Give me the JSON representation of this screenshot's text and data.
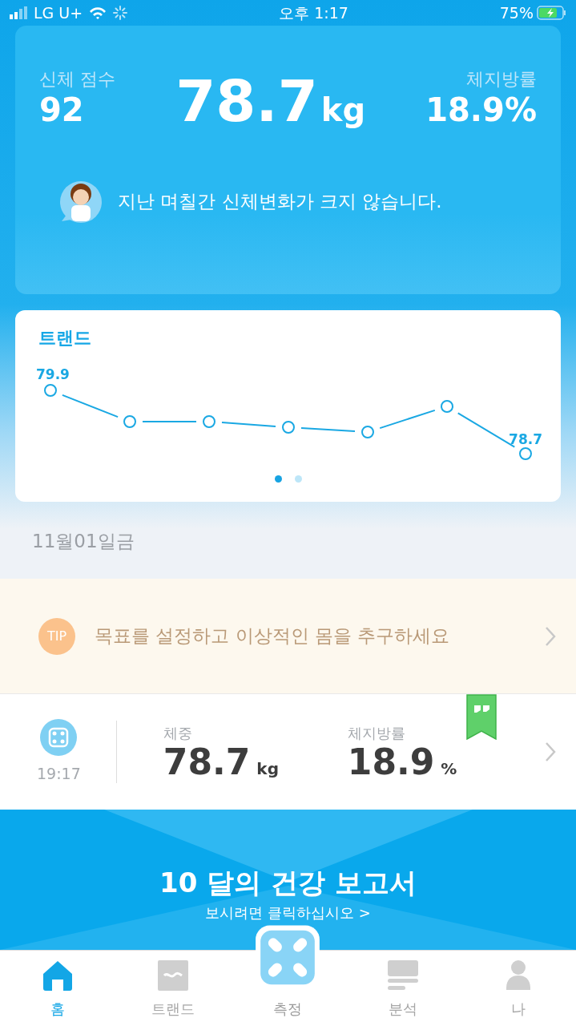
{
  "status_bar": {
    "carrier": "LG U+",
    "time": "오후 1:17",
    "battery": "75%"
  },
  "summary": {
    "score_label": "신체 점수",
    "score": "92",
    "weight": "78.7",
    "weight_unit": "kg",
    "fat_label": "체지방률",
    "fat": "18.9%",
    "message": "지난 며칠간 신체변화가 크지 않습니다."
  },
  "trend": {
    "title": "트랜드",
    "first_label": "79.9",
    "last_label": "78.7",
    "pager": [
      {
        "selected": true
      },
      {
        "selected": false
      }
    ]
  },
  "date": "11월01일금",
  "tip": {
    "badge": "TIP",
    "text": "목표를 설정하고 이상적인 몸을 추구하세요"
  },
  "record": {
    "time": "19:17",
    "metrics": [
      {
        "label": "체중",
        "value": "78.7",
        "unit": "kg"
      },
      {
        "label": "체지방률",
        "value": "18.9",
        "unit": "%"
      }
    ]
  },
  "report": {
    "title": "10 달의 건강 보고서",
    "subtitle": "보시려면 클릭하십시오 >"
  },
  "tabs": [
    {
      "kind": "home",
      "label": "홈",
      "selected": true
    },
    {
      "kind": "trend",
      "label": "트랜드",
      "selected": false
    },
    {
      "kind": "measure",
      "label": "측정",
      "selected": false
    },
    {
      "kind": "analysis",
      "label": "분석",
      "selected": false
    },
    {
      "kind": "me",
      "label": "나",
      "selected": false
    }
  ]
}
